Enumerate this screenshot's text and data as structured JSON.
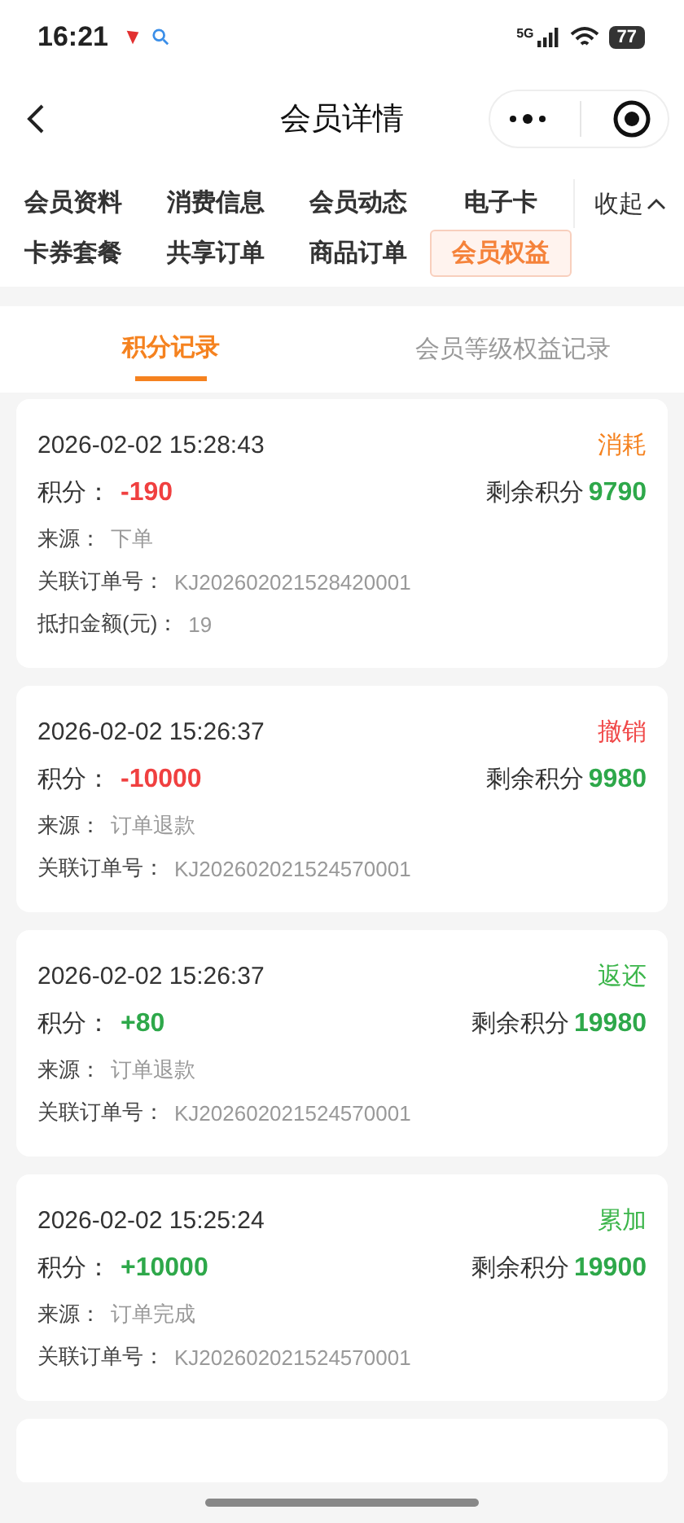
{
  "status_bar": {
    "time": "16:21",
    "network": "5G",
    "battery": "77"
  },
  "nav": {
    "title": "会员详情"
  },
  "tabs": [
    {
      "label": "会员资料",
      "selected": false
    },
    {
      "label": "消费信息",
      "selected": false
    },
    {
      "label": "会员动态",
      "selected": false
    },
    {
      "label": "电子卡",
      "selected": false
    },
    {
      "label": "卡券套餐",
      "selected": false
    },
    {
      "label": "共享订单",
      "selected": false
    },
    {
      "label": "商品订单",
      "selected": false
    },
    {
      "label": "会员权益",
      "selected": true
    }
  ],
  "collapse": "收起",
  "sub_tabs": [
    {
      "label": "积分记录",
      "selected": true
    },
    {
      "label": "会员等级权益记录",
      "selected": false
    }
  ],
  "records": [
    {
      "time": "2026-02-02 15:28:43",
      "type": "消耗",
      "color": "#f5821f",
      "points_label": "积分：",
      "points": "-190",
      "kind": "debit",
      "balance_label": "剩余积分",
      "balance": "9790",
      "details": [
        {
          "label": "来源：",
          "value": "下单"
        },
        {
          "label": "关联订单号：",
          "value": "KJ202602021528420001"
        },
        {
          "label": "抵扣金额(元)：",
          "value": "19"
        }
      ]
    },
    {
      "time": "2026-02-02 15:26:37",
      "type": "撤销",
      "color": "#f04848",
      "points_label": "积分：",
      "points": "-10000",
      "kind": "debit",
      "balance_label": "剩余积分",
      "balance": "9980",
      "details": [
        {
          "label": "来源：",
          "value": "订单退款"
        },
        {
          "label": "关联订单号：",
          "value": "KJ202602021524570001"
        }
      ]
    },
    {
      "time": "2026-02-02 15:26:37",
      "type": "返还",
      "color": "#3bb54a",
      "points_label": "积分：",
      "points": "+80",
      "kind": "credit",
      "balance_label": "剩余积分",
      "balance": "19980",
      "details": [
        {
          "label": "来源：",
          "value": "订单退款"
        },
        {
          "label": "关联订单号：",
          "value": "KJ202602021524570001"
        }
      ]
    },
    {
      "time": "2026-02-02 15:25:24",
      "type": "累加",
      "color": "#3bb54a",
      "points_label": "积分：",
      "points": "+10000",
      "kind": "credit",
      "balance_label": "剩余积分",
      "balance": "19900",
      "details": [
        {
          "label": "来源：",
          "value": "订单完成"
        },
        {
          "label": "关联订单号：",
          "value": "KJ202602021524570001"
        }
      ]
    }
  ]
}
